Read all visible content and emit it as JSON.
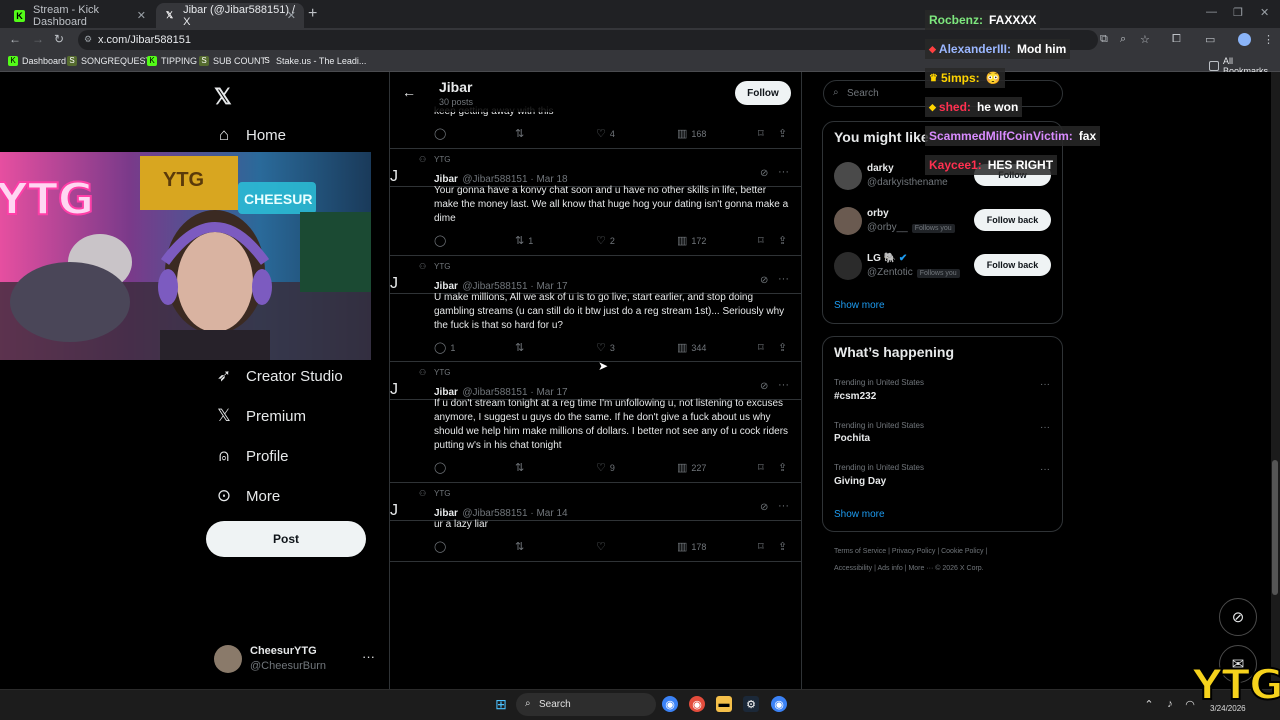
{
  "browser": {
    "tabs": [
      {
        "label": "Stream - Kick Dashboard",
        "favicon": "kick-icon",
        "color": "#53fc18"
      },
      {
        "label": "Jibar (@Jibar588151) / X",
        "favicon": "x-icon",
        "color": "#ffffff"
      }
    ],
    "url": "x.com/Jibar588151",
    "bookmarks": [
      {
        "label": "Dashboard"
      },
      {
        "label": "SONGREQUESTS"
      },
      {
        "label": "TIPPING"
      },
      {
        "label": "SUB COUNT"
      },
      {
        "label": "Stake.us - The Leadi..."
      }
    ],
    "all_bookmarks": "All Bookmarks"
  },
  "nav": {
    "home": "Home",
    "creator_studio": "Creator Studio",
    "premium": "Premium",
    "profile": "Profile",
    "more": "More",
    "post": "Post",
    "account_name": "CheesurYTG",
    "account_handle": "@CheesurBurn"
  },
  "profile_header": {
    "name": "Jibar",
    "posts": "30 posts",
    "follow": "Follow",
    "partial_text": "keep getting away with this"
  },
  "prev_tweet_actions": {
    "likes": "4",
    "views": "168"
  },
  "tweets": [
    {
      "context": "YTG",
      "name": "Jibar",
      "meta": "@Jibar588151 · Mar 18",
      "avatar": "J",
      "body": "Your gonna have a konvy chat soon and u have no other skills in life, better make the money last. We all know that huge hog your dating isn't gonna make a dime",
      "replies": "",
      "reposts": "1",
      "likes": "2",
      "views": "172"
    },
    {
      "context": "YTG",
      "name": "Jibar",
      "meta": "@Jibar588151 · Mar 17",
      "avatar": "J",
      "body": "U make millions, All we ask of u is to go live, start earlier, and stop doing gambling streams (u can still do it btw just do a reg stream 1st)... Seriously why the fuck is that so hard for u?",
      "replies": "1",
      "reposts": "",
      "likes": "3",
      "views": "344"
    },
    {
      "context": "YTG",
      "name": "Jibar",
      "meta": "@Jibar588151 · Mar 17",
      "avatar": "J",
      "body": "If u don't stream tonight at a reg time I'm unfollowing u, not listening to excuses anymore, I suggest u guys do the same. If he don't give a fuck about us why should we help him make millions of dollars. I better not see any of u cock riders  putting w's in his chat tonight",
      "replies": "",
      "reposts": "",
      "likes": "9",
      "views": "227"
    },
    {
      "context": "YTG",
      "name": "Jibar",
      "meta": "@Jibar588151 · Mar 14",
      "avatar": "J",
      "body": "ur a lazy liar",
      "replies": "",
      "reposts": "",
      "likes": "",
      "views": "178"
    }
  ],
  "right": {
    "search_placeholder": "Search",
    "wtf_title": "You might like",
    "wtf": [
      {
        "name": "darky",
        "handle": "@darkyisthename",
        "follows_you": "",
        "button": "Follow"
      },
      {
        "name": "orby",
        "handle": "@orby__",
        "follows_you": "Follows you",
        "button": "Follow back"
      },
      {
        "name": "LG 🐘",
        "handle": "@Zentotic",
        "follows_you": "Follows you",
        "button": "Follow back"
      }
    ],
    "show_more": "Show more",
    "happening_title": "What’s happening",
    "trends": [
      {
        "category": "Trending in United States",
        "name": "#csm232"
      },
      {
        "category": "Trending in United States",
        "name": "Pochita"
      },
      {
        "category": "Trending in United States",
        "name": "Giving Day"
      }
    ],
    "footer_line1": "Terms of Service  |  Privacy Policy  |  Cookie Policy  |",
    "footer_line2": "Accessibility  |  Ads info  |  More ···  © 2026 X Corp."
  },
  "chat_overlay": [
    {
      "user": "Rocbenz:",
      "msg": "FAXXXX",
      "color": "#7ee87e"
    },
    {
      "user": "AlexanderIII:",
      "msg": "Mod him",
      "color": "#9bb7ff"
    },
    {
      "user": "5imps:",
      "msg": "😳",
      "color": "#ffd400"
    },
    {
      "user": "shed:",
      "msg": "he won",
      "color": "#ff3050"
    },
    {
      "user": "ScammedMilfCoinVictim:",
      "msg": "fax",
      "color": "#d98cff"
    },
    {
      "user": "Kaycee1:",
      "msg": "HES RIGHT",
      "color": "#ff3050"
    }
  ],
  "taskbar": {
    "search": "Search",
    "date": "3/24/2026"
  },
  "watermark": "YTG",
  "webcam_texts": {
    "neon": "YTG",
    "flag": "YTG",
    "sign": "CHEESUR"
  }
}
